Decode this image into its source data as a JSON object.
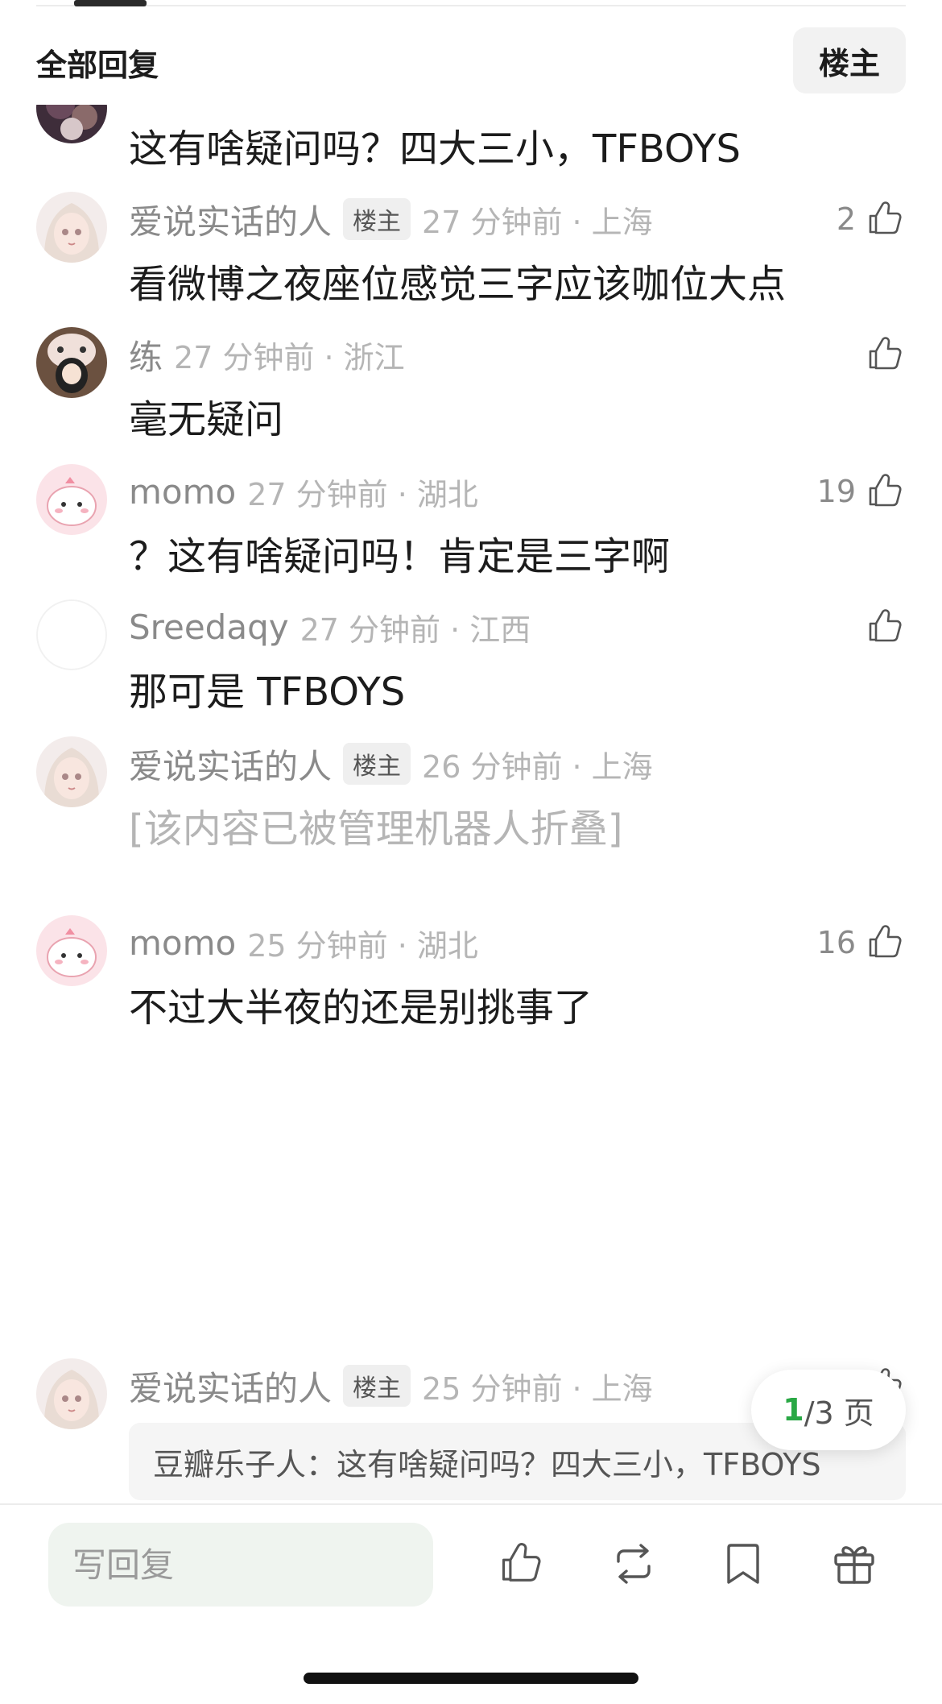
{
  "header": {
    "title": "全部回复",
    "op_filter": "楼主"
  },
  "comments": [
    {
      "author": "",
      "is_op": false,
      "time": "",
      "text": "这有啥疑问吗？四大三小，TFBOYS",
      "likes": "",
      "avatar": "dark-avatar"
    },
    {
      "author": "爱说实话的人",
      "is_op": true,
      "op_label": "楼主",
      "time": "27 分钟前 · 上海",
      "text": "看微博之夜座位感觉三字应该咖位大点",
      "likes": "2",
      "avatar": "anime-girl-avatar"
    },
    {
      "author": "练",
      "is_op": false,
      "time": "27 分钟前 · 浙江",
      "text": "毫无疑问",
      "likes": "",
      "avatar": "pig-hat-avatar"
    },
    {
      "author": "momo",
      "is_op": false,
      "time": "27 分钟前 · 湖北",
      "text": "？这有啥疑问吗！肯定是三字啊",
      "likes": "19",
      "avatar": "pink-blob-avatar"
    },
    {
      "author": "Sreedaqy",
      "is_op": false,
      "time": "27 分钟前 · 江西",
      "text": "那可是 TFBOYS",
      "likes": "",
      "avatar": "blank-avatar"
    },
    {
      "author": "爱说实话的人",
      "is_op": true,
      "op_label": "楼主",
      "time": "26 分钟前 · 上海",
      "text": "[该内容已被管理机器人折叠]",
      "likes": "",
      "avatar": "anime-girl-avatar"
    },
    {
      "author": "momo",
      "is_op": false,
      "time": "25 分钟前 · 湖北",
      "text": "不过大半夜的还是别挑事了",
      "likes": "16",
      "avatar": "pink-blob-avatar"
    },
    {
      "author": "爱说实话的人",
      "is_op": true,
      "op_label": "楼主",
      "time": "25 分钟前 · 上海",
      "quote": "豆瓣乐子人：这有啥疑问吗？四大三小，TFBOYS",
      "likes": "",
      "avatar": "anime-girl-avatar"
    }
  ],
  "pager": {
    "current": "1",
    "rest": "/3 页"
  },
  "bottom_bar": {
    "reply_placeholder": "写回复"
  },
  "colors": {
    "accent_green": "#2aa845",
    "meta_gray": "#8a8a8a",
    "time_gray": "#b5b5b5"
  }
}
